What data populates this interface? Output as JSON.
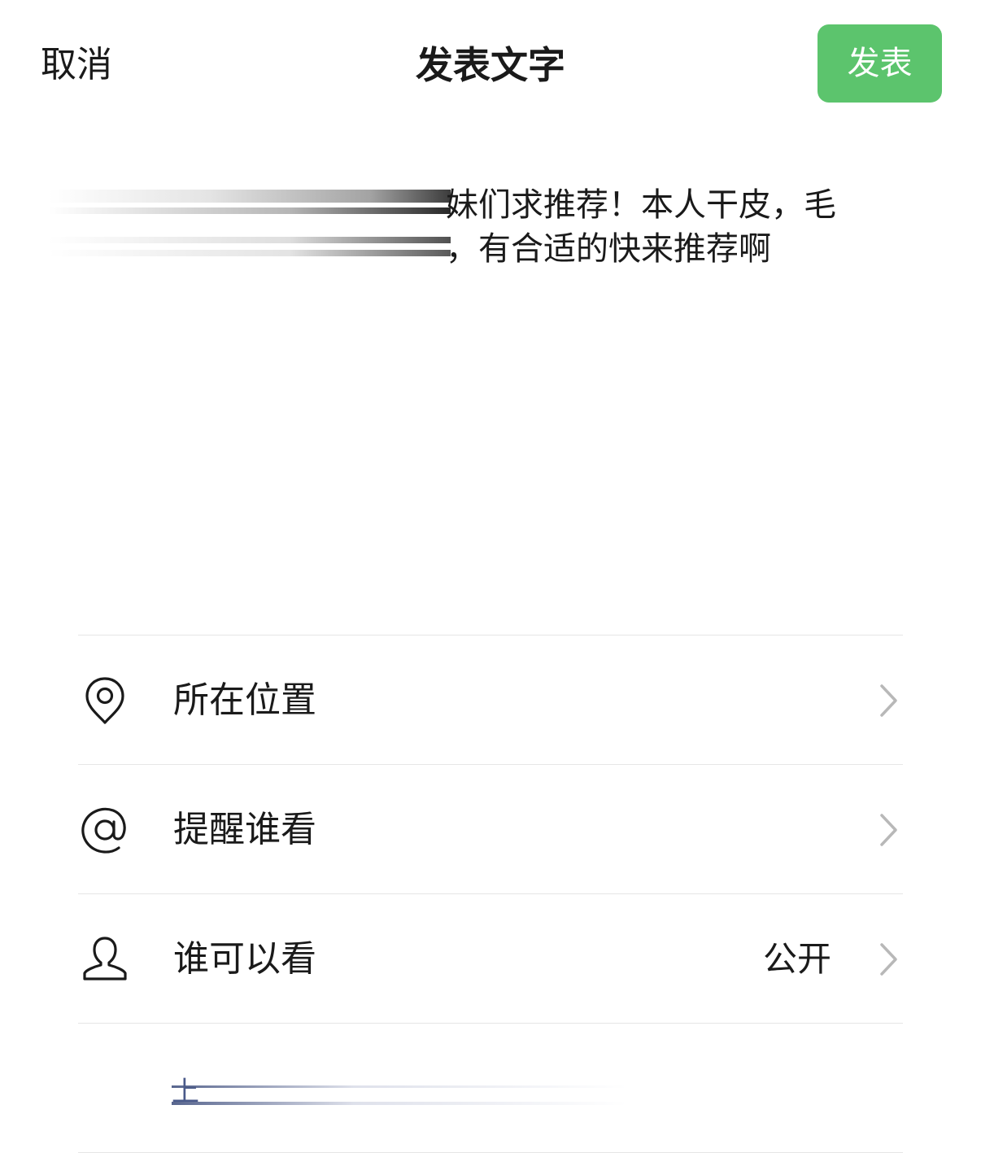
{
  "header": {
    "cancel_label": "取消",
    "title": "发表文字",
    "publish_label": "发表"
  },
  "post": {
    "line1_visible": "妹们求推荐！本人干皮，毛",
    "line2_visible": "，有合适的快来推荐啊"
  },
  "settings": {
    "items": [
      {
        "label": "所在位置",
        "icon": "location-pin-icon"
      },
      {
        "label": "提醒谁看",
        "icon": "at-sign-icon"
      },
      {
        "label": "谁可以看",
        "value": "公开",
        "icon": "person-icon"
      }
    ],
    "blurred_row_glyph": "上"
  },
  "colors": {
    "accent": "#5cc46d",
    "divider": "#e6e6e6",
    "chevron": "#b8b8b8"
  }
}
